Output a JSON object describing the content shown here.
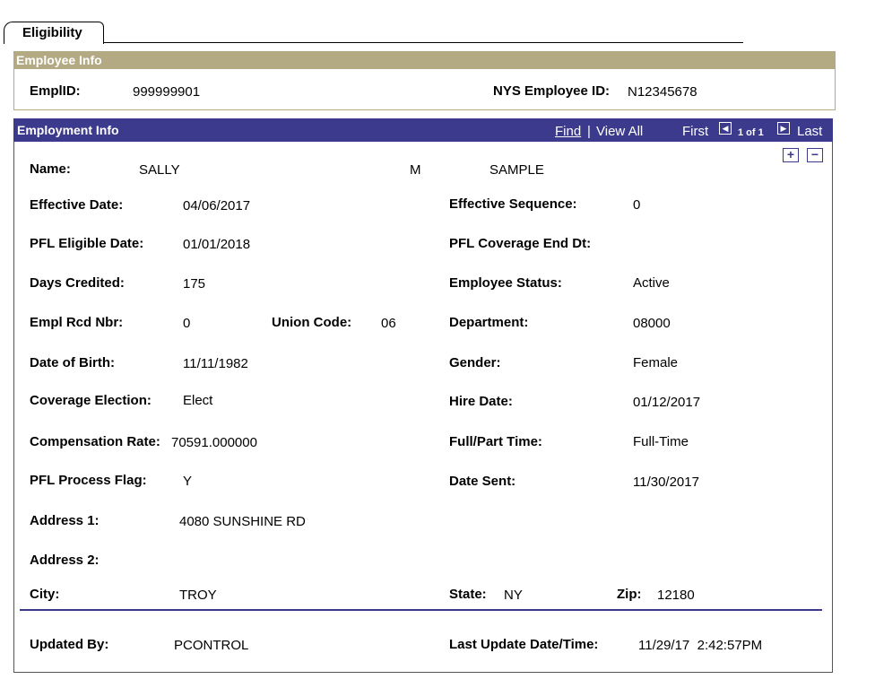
{
  "tab": {
    "label": "Eligibility"
  },
  "employee_info": {
    "title": "Employee Info",
    "emplid_label": "EmplID:",
    "emplid_value": "999999901",
    "nys_id_label": "NYS Employee ID:",
    "nys_id_value": "N12345678"
  },
  "employment_info": {
    "title": "Employment Info",
    "nav": {
      "find": "Find",
      "separator": "|",
      "view_all": "View All",
      "first": "First",
      "count": "1 of 1",
      "last": "Last",
      "prev_icon": "◀",
      "next_icon": "▶"
    },
    "add_icon": "+",
    "remove_icon": "−",
    "fields": {
      "name_label": "Name:",
      "first_name": "SALLY",
      "middle_initial": "M",
      "last_name": "SAMPLE",
      "effective_date_label": "Effective Date:",
      "effective_date": "04/06/2017",
      "effective_seq_label": "Effective Sequence:",
      "effective_seq": "0",
      "pfl_eligible_label": "PFL Eligible Date:",
      "pfl_eligible": "01/01/2018",
      "pfl_end_label": "PFL Coverage End Dt:",
      "pfl_end": "",
      "days_credited_label": "Days Credited:",
      "days_credited": "175",
      "employee_status_label": "Employee Status:",
      "employee_status": "Active",
      "empl_rcd_label": "Empl Rcd Nbr:",
      "empl_rcd": "0",
      "union_code_label": "Union Code:",
      "union_code": "06",
      "department_label": "Department:",
      "department": "08000",
      "dob_label": "Date of Birth:",
      "dob": "11/11/1982",
      "gender_label": "Gender:",
      "gender": "Female",
      "coverage_label": "Coverage Election:",
      "coverage": "Elect",
      "hire_date_label": "Hire Date:",
      "hire_date": "01/12/2017",
      "comp_rate_label": "Compensation Rate:",
      "comp_rate": "70591.000000",
      "full_part_label": "Full/Part Time:",
      "full_part": "Full-Time",
      "process_flag_label": "PFL Process Flag:",
      "process_flag": "Y",
      "date_sent_label": "Date Sent:",
      "date_sent": "11/30/2017",
      "address1_label": "Address 1:",
      "address1": "4080 SUNSHINE RD",
      "address2_label": "Address 2:",
      "address2": "",
      "city_label": "City:",
      "city": "TROY",
      "state_label": "State:",
      "state": "NY",
      "zip_label": "Zip:",
      "zip": "12180",
      "updated_by_label": "Updated By:",
      "updated_by": "PCONTROL",
      "last_update_label": "Last Update Date/Time:",
      "last_update": "11/29/17  2:42:57PM"
    }
  },
  "colors": {
    "employee_header": "#b3a983",
    "employment_header": "#3c3a8c"
  }
}
